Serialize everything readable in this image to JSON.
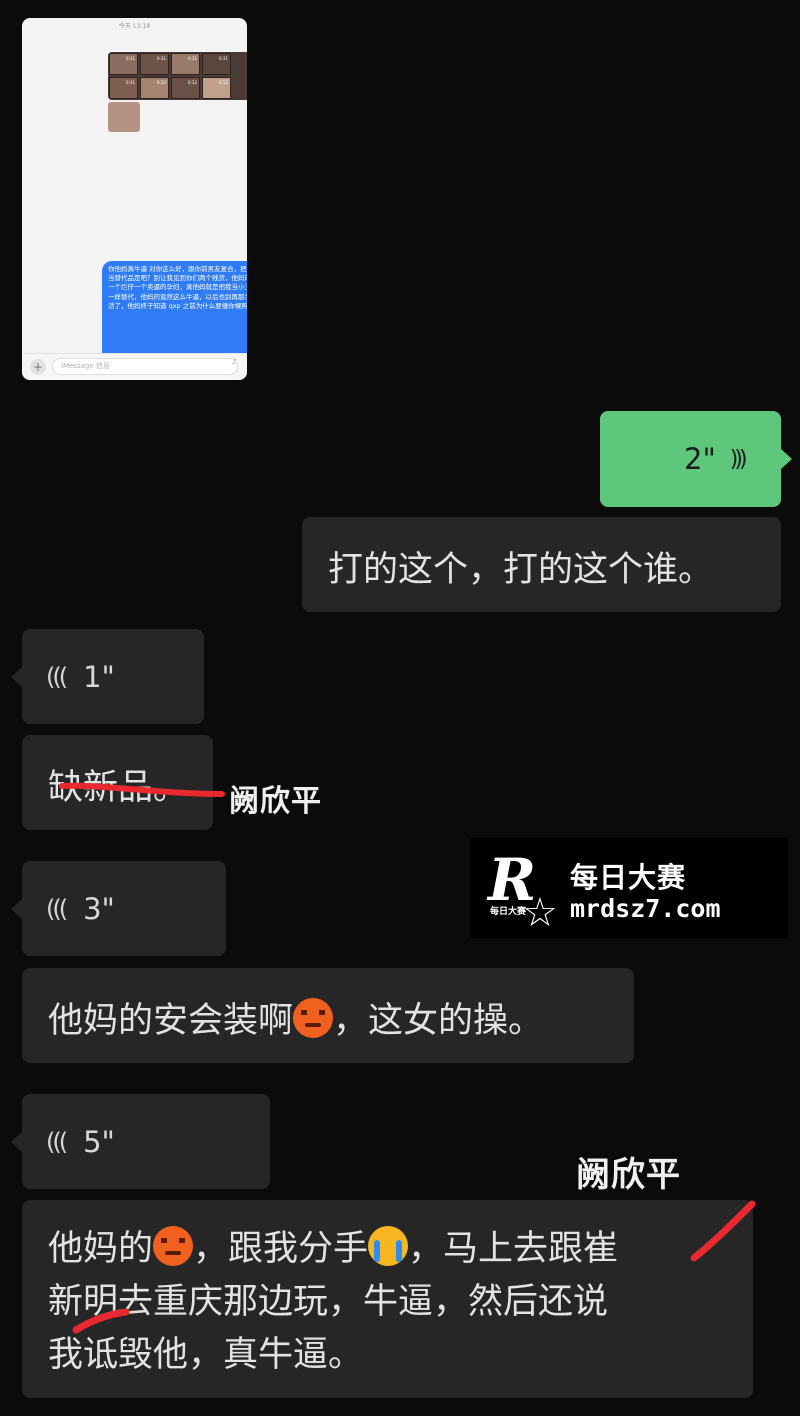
{
  "embedded_screenshot": {
    "status_time": "今天 13:18",
    "photo_durations": [
      "0:31",
      "0:31",
      "0:31",
      "0:31",
      "0:31",
      "0:32",
      "0:32",
      "0:32"
    ],
    "blue_bubble_text": "你他妈真牛逼 对你这么好，跟你前男友复合，把我当替代品是吧？别让我见到你们两个贱货，他妈的一个烂仔一个卖逼的孕妇，真他妈就是把我当小三一样替代，他妈的竟然这么牛逼，以后也别再那关活了，他妈终于知道 qxp 之前为什么要缠你裸照",
    "input_placeholder": "iMessage 信息",
    "plus_icon": "+",
    "mic_icon": "♪"
  },
  "messages": [
    {
      "side": "right",
      "type": "voice",
      "duration": "2\""
    },
    {
      "side": "right",
      "type": "text",
      "text": "打的这个，打的这个谁。"
    },
    {
      "side": "left",
      "type": "voice",
      "duration": "1\""
    },
    {
      "side": "left",
      "type": "text",
      "text": "缺新品。"
    },
    {
      "side": "left",
      "type": "voice",
      "duration": "3\""
    },
    {
      "side": "left",
      "type": "text",
      "parts": [
        "他妈的安会装啊",
        "，这女的操。"
      ]
    },
    {
      "side": "left",
      "type": "voice",
      "duration": "5\""
    },
    {
      "side": "left",
      "type": "text",
      "lines": [
        [
          "他妈的",
          "，跟我分手",
          "，马上去跟崔"
        ],
        "新明去重庆那边玩，牛逼，然后还说",
        "我诋毁他，真牛逼。"
      ]
    }
  ],
  "annotations": {
    "name_1": "阙欣平",
    "name_2": "阙欣平"
  },
  "watermark": {
    "logo_letter": "R",
    "logo_small": "每日大赛",
    "brand_cn": "每日大赛",
    "url": "mrdsz7.com"
  },
  "icons": {
    "voice_in": "(((",
    "voice_out": ")))"
  },
  "colors": {
    "background": "#0b0b0b",
    "bubble_dark": "#262626",
    "bubble_green": "#5ec77b",
    "scribble_red": "#e8292f",
    "imessage_blue": "#2f7cf6"
  }
}
